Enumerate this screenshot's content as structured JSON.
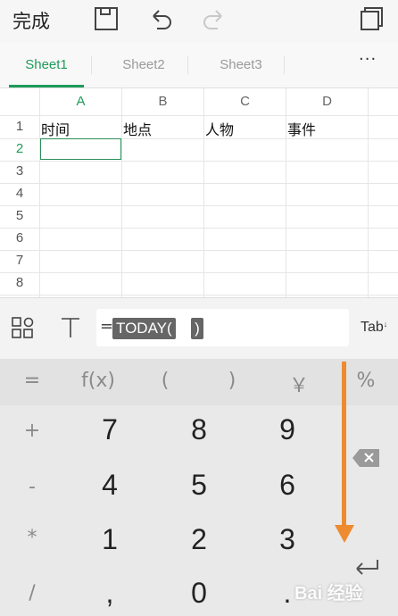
{
  "toolbar": {
    "done_label": "完成",
    "icons": [
      "save-icon",
      "undo-icon",
      "redo-icon",
      "window-switch-icon"
    ]
  },
  "tabs": [
    {
      "label": "Sheet1",
      "active": true
    },
    {
      "label": "Sheet2",
      "active": false
    },
    {
      "label": "Sheet3",
      "active": false
    }
  ],
  "more_label": "···",
  "grid": {
    "columns": [
      "A",
      "B",
      "C",
      "D"
    ],
    "rows": [
      "1",
      "2",
      "3",
      "4",
      "5",
      "6",
      "7",
      "8"
    ],
    "row1": [
      "时间",
      "地点",
      "人物",
      "事件"
    ],
    "selected": "A2"
  },
  "formula": {
    "equals": "=",
    "function": "TODAY(",
    "close": ")",
    "tab_label": "Tab"
  },
  "keyboard": {
    "fn_row": [
      "=",
      "f(x)",
      "(",
      ")",
      "￥",
      "%"
    ],
    "left_col": [
      "+",
      "-",
      "*",
      "/"
    ],
    "digits": [
      [
        "7",
        "8",
        "9"
      ],
      [
        "4",
        "5",
        "6"
      ],
      [
        "1",
        "2",
        "3"
      ],
      [
        ",",
        "0",
        "."
      ]
    ]
  },
  "watermark": "Bai 经验",
  "colors": {
    "accent": "#1e9b5a",
    "arrow": "#ee8a30"
  }
}
